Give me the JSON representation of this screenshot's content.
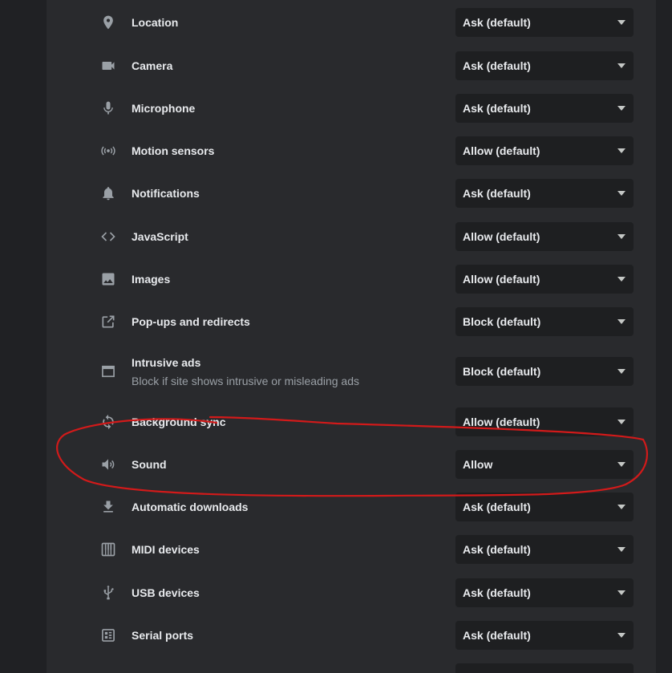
{
  "permissions": [
    {
      "label": "Location",
      "value": "Ask (default)",
      "icon": "location-pin-icon"
    },
    {
      "label": "Camera",
      "value": "Ask (default)",
      "icon": "camera-icon"
    },
    {
      "label": "Microphone",
      "value": "Ask (default)",
      "icon": "microphone-icon"
    },
    {
      "label": "Motion sensors",
      "value": "Allow (default)",
      "icon": "motion-sensors-icon"
    },
    {
      "label": "Notifications",
      "value": "Ask (default)",
      "icon": "bell-icon"
    },
    {
      "label": "JavaScript",
      "value": "Allow (default)",
      "icon": "code-icon"
    },
    {
      "label": "Images",
      "value": "Allow (default)",
      "icon": "image-icon"
    },
    {
      "label": "Pop-ups and redirects",
      "value": "Block (default)",
      "icon": "open-in-new-icon"
    },
    {
      "label": "Intrusive ads",
      "sublabel": "Block if site shows intrusive or misleading ads",
      "value": "Block (default)",
      "icon": "window-icon"
    },
    {
      "label": "Background sync",
      "value": "Allow (default)",
      "icon": "sync-icon"
    },
    {
      "label": "Sound",
      "value": "Allow",
      "icon": "speaker-icon"
    },
    {
      "label": "Automatic downloads",
      "value": "Ask (default)",
      "icon": "download-icon"
    },
    {
      "label": "MIDI devices",
      "value": "Ask (default)",
      "icon": "piano-keys-icon"
    },
    {
      "label": "USB devices",
      "value": "Ask (default)",
      "icon": "usb-icon"
    },
    {
      "label": "Serial ports",
      "value": "Ask (default)",
      "icon": "serial-port-icon"
    }
  ],
  "colors": {
    "background": "#202124",
    "card": "#292a2d",
    "select_bg": "#1e1f21",
    "text": "#e8eaed",
    "secondary_text": "#9aa0a6",
    "icon": "#9aa0a6",
    "annotation": "#d21a1a"
  }
}
